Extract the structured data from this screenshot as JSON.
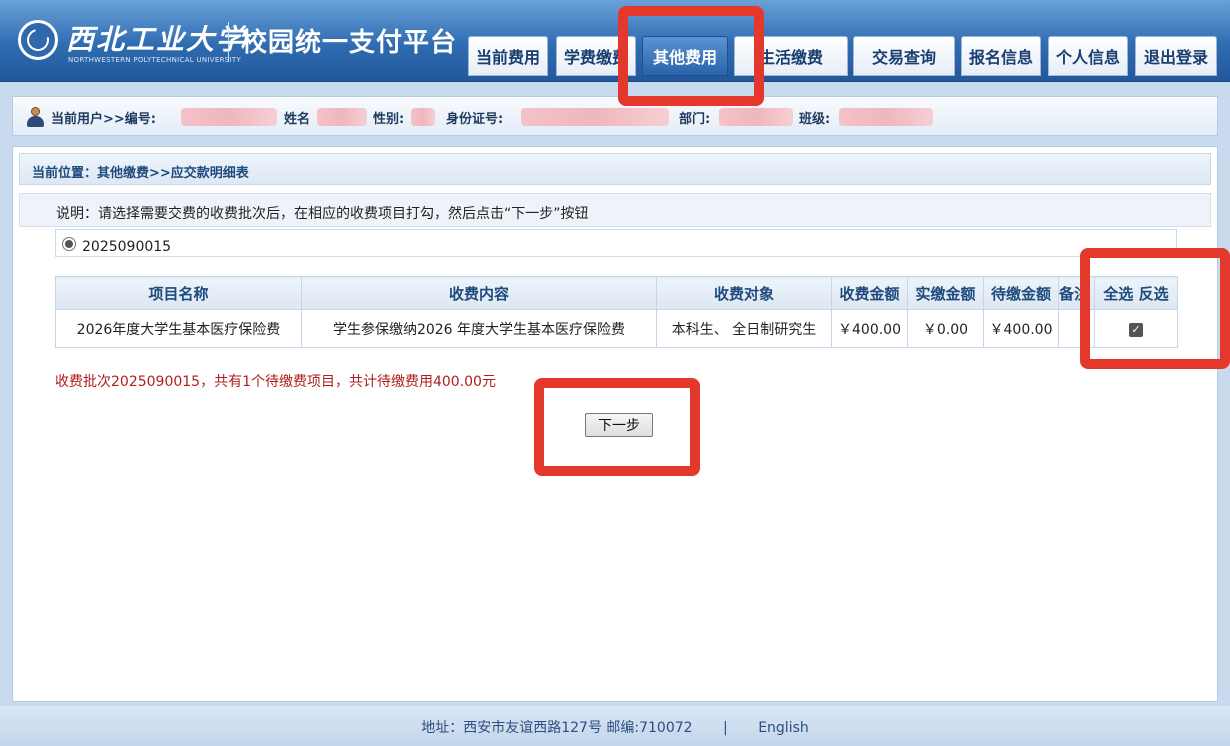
{
  "header": {
    "logo_cn": "西北工业大学",
    "logo_en": "NORTHWESTERN POLYTECHNICAL UNIVERSITY",
    "platform_title": "校园统一支付平台"
  },
  "nav": {
    "current_fees": "当前费用",
    "tuition": "学费缴费",
    "other_fees": "其他费用",
    "living_fees": "生活缴费",
    "transactions": "交易查询",
    "registration": "报名信息",
    "personal_info": "个人信息",
    "logout": "退出登录",
    "active": "other_fees"
  },
  "userbar": {
    "prefix": "当前用户>>编号:",
    "name_label": "姓名",
    "gender_label": "性别:",
    "id_label": "身份证号:",
    "dept_label": "部门:",
    "class_label": "班级:"
  },
  "breadcrumb": "当前位置：其他缴费>>应交款明细表",
  "notice": "说明：请选择需要交费的收费批次后，在相应的收费项目打勾，然后点击“下一步”按钮",
  "batch": {
    "id": "2025090015",
    "selected": true
  },
  "table": {
    "headers": {
      "item_name": "项目名称",
      "content": "收费内容",
      "target": "收费对象",
      "amount": "收费金额",
      "paid": "实缴金额",
      "pending": "待缴金额",
      "remark": "备注",
      "select_all": "全选",
      "invert": "反选"
    },
    "rows": [
      {
        "item_name": "2026年度大学生基本医疗保险费",
        "content": "学生参保缴纳2026 年度大学生基本医疗保险费",
        "target": "本科生、 全日制研究生",
        "amount": "￥400.00",
        "paid": "￥0.00",
        "pending": "￥400.00",
        "remark": "",
        "checked": true
      }
    ]
  },
  "summary": "收费批次2025090015，共有1个待缴费项目，共计待缴费用400.00元",
  "next_button": "下一步",
  "footer": {
    "address": "地址：西安市友谊西路127号 邮编:710072",
    "separator": "|",
    "english": "English"
  },
  "colors": {
    "header_blue": "#2f6cb2",
    "annotation_red": "#e5382d",
    "summary_red": "#b01e1e"
  }
}
